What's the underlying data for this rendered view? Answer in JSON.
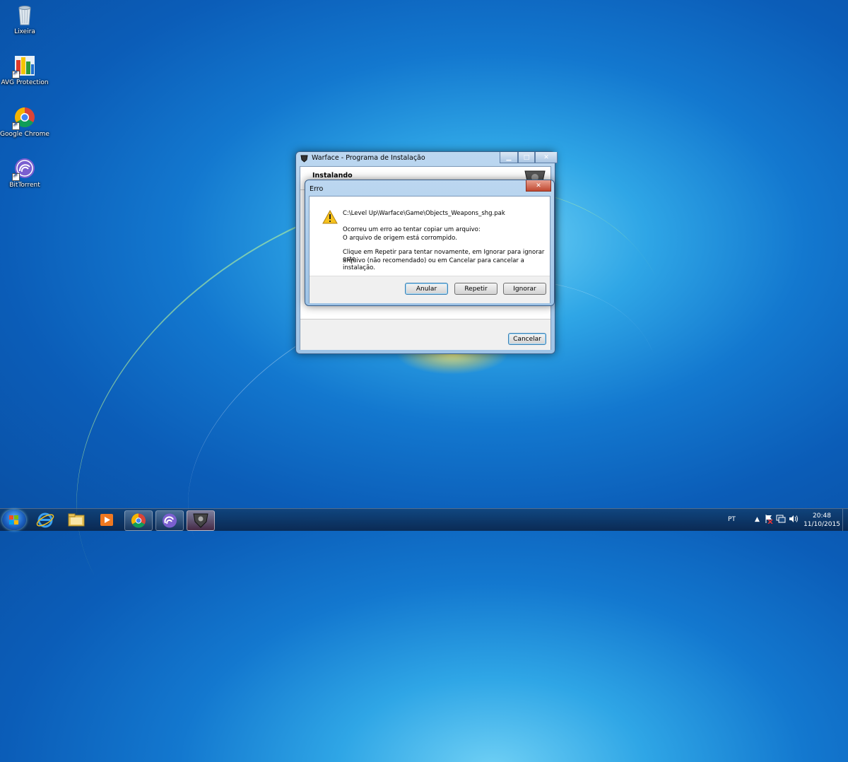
{
  "desktop": {
    "icons": [
      {
        "label": "Lixeira",
        "icon": "recycle-bin-icon"
      },
      {
        "label": "AVG Protection",
        "icon": "avg-icon"
      },
      {
        "label": "Google Chrome",
        "icon": "chrome-icon"
      },
      {
        "label": "BitTorrent",
        "icon": "bittorrent-icon"
      }
    ]
  },
  "installer": {
    "title": "Warface - Programa de Instalação",
    "heading": "Instalando",
    "cancel_label": "Cancelar"
  },
  "error_dialog": {
    "title": "Erro",
    "icon": "warning-icon",
    "path": "C:\\Level Up\\Warface\\Game\\Objects_Weapons_shg.pak",
    "message_line1": "Ocorreu um erro ao tentar copiar um arquivo:",
    "message_line2": "O arquivo de origem está corrompido.",
    "instructions_line1": "Clique em Repetir para tentar novamente, em Ignorar para ignorar este",
    "instructions_line2": "arquivo (não recomendado) ou em Cancelar para cancelar a instalação.",
    "buttons": {
      "abort": "Anular",
      "retry": "Repetir",
      "ignore": "Ignorar"
    }
  },
  "taskbar": {
    "items": [
      "internet-explorer-icon",
      "folder-icon",
      "media-player-icon",
      "chrome-icon",
      "bittorrent-icon",
      "warface-icon"
    ],
    "language": "PT",
    "time": "20:48",
    "date": "11/10/2015"
  },
  "colors": {
    "desktop_blue": "#1378cf",
    "accent_button": "#3c7fb1"
  }
}
